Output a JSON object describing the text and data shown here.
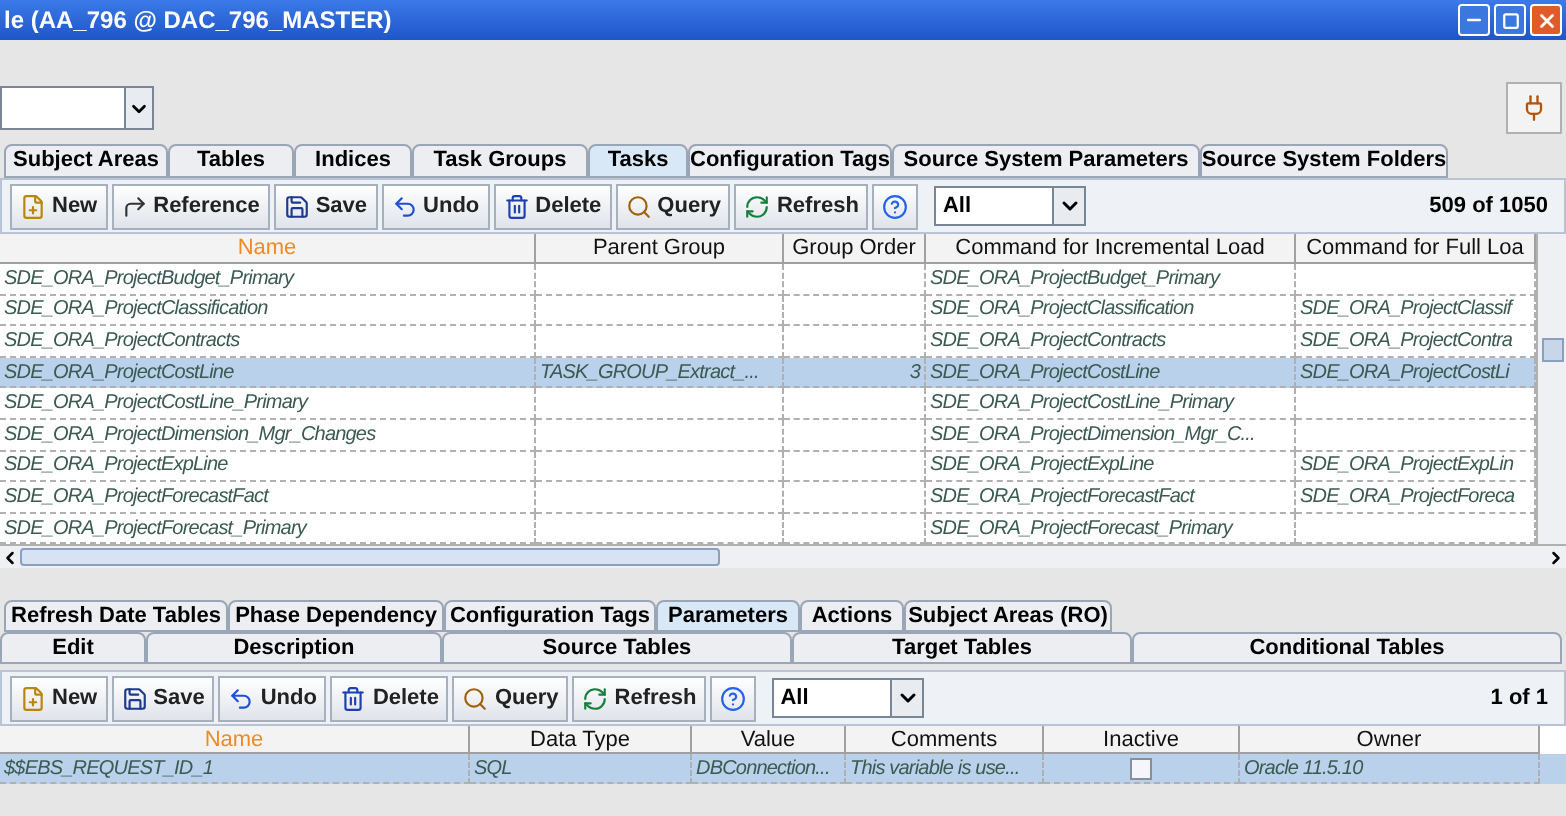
{
  "window": {
    "title": "le (AA_796 @ DAC_796_MASTER)"
  },
  "top_tabs": [
    {
      "label": "Subject Areas",
      "selected": false
    },
    {
      "label": "Tables",
      "selected": false
    },
    {
      "label": "Indices",
      "selected": false
    },
    {
      "label": "Task Groups",
      "selected": false
    },
    {
      "label": "Tasks",
      "selected": true
    },
    {
      "label": "Configuration Tags",
      "selected": false
    },
    {
      "label": "Source System Parameters",
      "selected": false
    },
    {
      "label": "Source System Folders",
      "selected": false
    }
  ],
  "toolbar": {
    "buttons": [
      {
        "kind": "new",
        "label": "New"
      },
      {
        "kind": "reference",
        "label": "Reference"
      },
      {
        "kind": "save",
        "label": "Save"
      },
      {
        "kind": "undo",
        "label": "Undo"
      },
      {
        "kind": "delete",
        "label": "Delete"
      },
      {
        "kind": "query",
        "label": "Query"
      },
      {
        "kind": "refresh",
        "label": "Refresh"
      },
      {
        "kind": "help"
      }
    ],
    "filter": "All",
    "count": "509 of 1050"
  },
  "table": {
    "columns": [
      {
        "label": "Name",
        "sorted": true
      },
      {
        "label": "Parent Group",
        "sorted": false
      },
      {
        "label": "Group Order",
        "sorted": false
      },
      {
        "label": "Command for Incremental Load",
        "sorted": false
      },
      {
        "label": "Command for Full Loa",
        "sorted": false
      }
    ],
    "rows": [
      {
        "selected": false,
        "cells": [
          "SDE_ORA_ProjectBudget_Primary",
          "",
          "",
          "SDE_ORA_ProjectBudget_Primary",
          ""
        ]
      },
      {
        "selected": false,
        "cells": [
          "SDE_ORA_ProjectClassification",
          "",
          "",
          "SDE_ORA_ProjectClassification",
          "SDE_ORA_ProjectClassif"
        ]
      },
      {
        "selected": false,
        "cells": [
          "SDE_ORA_ProjectContracts",
          "",
          "",
          "SDE_ORA_ProjectContracts",
          "SDE_ORA_ProjectContra"
        ]
      },
      {
        "selected": true,
        "cells": [
          "SDE_ORA_ProjectCostLine",
          "TASK_GROUP_Extract_...",
          "3",
          "SDE_ORA_ProjectCostLine",
          "SDE_ORA_ProjectCostLi"
        ]
      },
      {
        "selected": false,
        "cells": [
          "SDE_ORA_ProjectCostLine_Primary",
          "",
          "",
          "SDE_ORA_ProjectCostLine_Primary",
          ""
        ]
      },
      {
        "selected": false,
        "cells": [
          "SDE_ORA_ProjectDimension_Mgr_Changes",
          "",
          "",
          "SDE_ORA_ProjectDimension_Mgr_C...",
          ""
        ]
      },
      {
        "selected": false,
        "cells": [
          "SDE_ORA_ProjectExpLine",
          "",
          "",
          "SDE_ORA_ProjectExpLine",
          "SDE_ORA_ProjectExpLin"
        ]
      },
      {
        "selected": false,
        "cells": [
          "SDE_ORA_ProjectForecastFact",
          "",
          "",
          "SDE_ORA_ProjectForecastFact",
          "SDE_ORA_ProjectForeca"
        ]
      },
      {
        "selected": false,
        "cells": [
          "SDE_ORA_ProjectForecast_Primary",
          "",
          "",
          "SDE_ORA_ProjectForecast_Primary",
          ""
        ]
      }
    ]
  },
  "detail_tabs": [
    [
      {
        "label": "Refresh Date Tables",
        "selected": false
      },
      {
        "label": "Phase Dependency",
        "selected": false
      },
      {
        "label": "Configuration Tags",
        "selected": false
      },
      {
        "label": "Parameters",
        "selected": true
      },
      {
        "label": "Actions",
        "selected": false
      },
      {
        "label": "Subject Areas (RO)",
        "selected": false
      }
    ],
    [
      {
        "label": "Edit",
        "selected": false
      },
      {
        "label": "Description",
        "selected": false
      },
      {
        "label": "Source Tables",
        "selected": false
      },
      {
        "label": "Target Tables",
        "selected": false
      },
      {
        "label": "Conditional Tables",
        "selected": false
      }
    ]
  ],
  "detail_toolbar": {
    "buttons": [
      {
        "kind": "new",
        "label": "New"
      },
      {
        "kind": "save",
        "label": "Save"
      },
      {
        "kind": "undo",
        "label": "Undo"
      },
      {
        "kind": "delete",
        "label": "Delete"
      },
      {
        "kind": "query",
        "label": "Query"
      },
      {
        "kind": "refresh",
        "label": "Refresh"
      },
      {
        "kind": "help"
      }
    ],
    "filter": "All",
    "count": "1 of 1"
  },
  "detail_table": {
    "columns": [
      {
        "label": "Name",
        "sorted": true
      },
      {
        "label": "Data Type",
        "sorted": false
      },
      {
        "label": "Value",
        "sorted": false
      },
      {
        "label": "Comments",
        "sorted": false
      },
      {
        "label": "Inactive",
        "sorted": false
      },
      {
        "label": "Owner",
        "sorted": false
      }
    ],
    "rows": [
      {
        "selected": true,
        "inactive": false,
        "cells": [
          "$$EBS_REQUEST_ID_1",
          "SQL",
          "DBConnection...",
          "This variable is use...",
          "",
          "Oracle 11.5.10"
        ]
      }
    ]
  }
}
